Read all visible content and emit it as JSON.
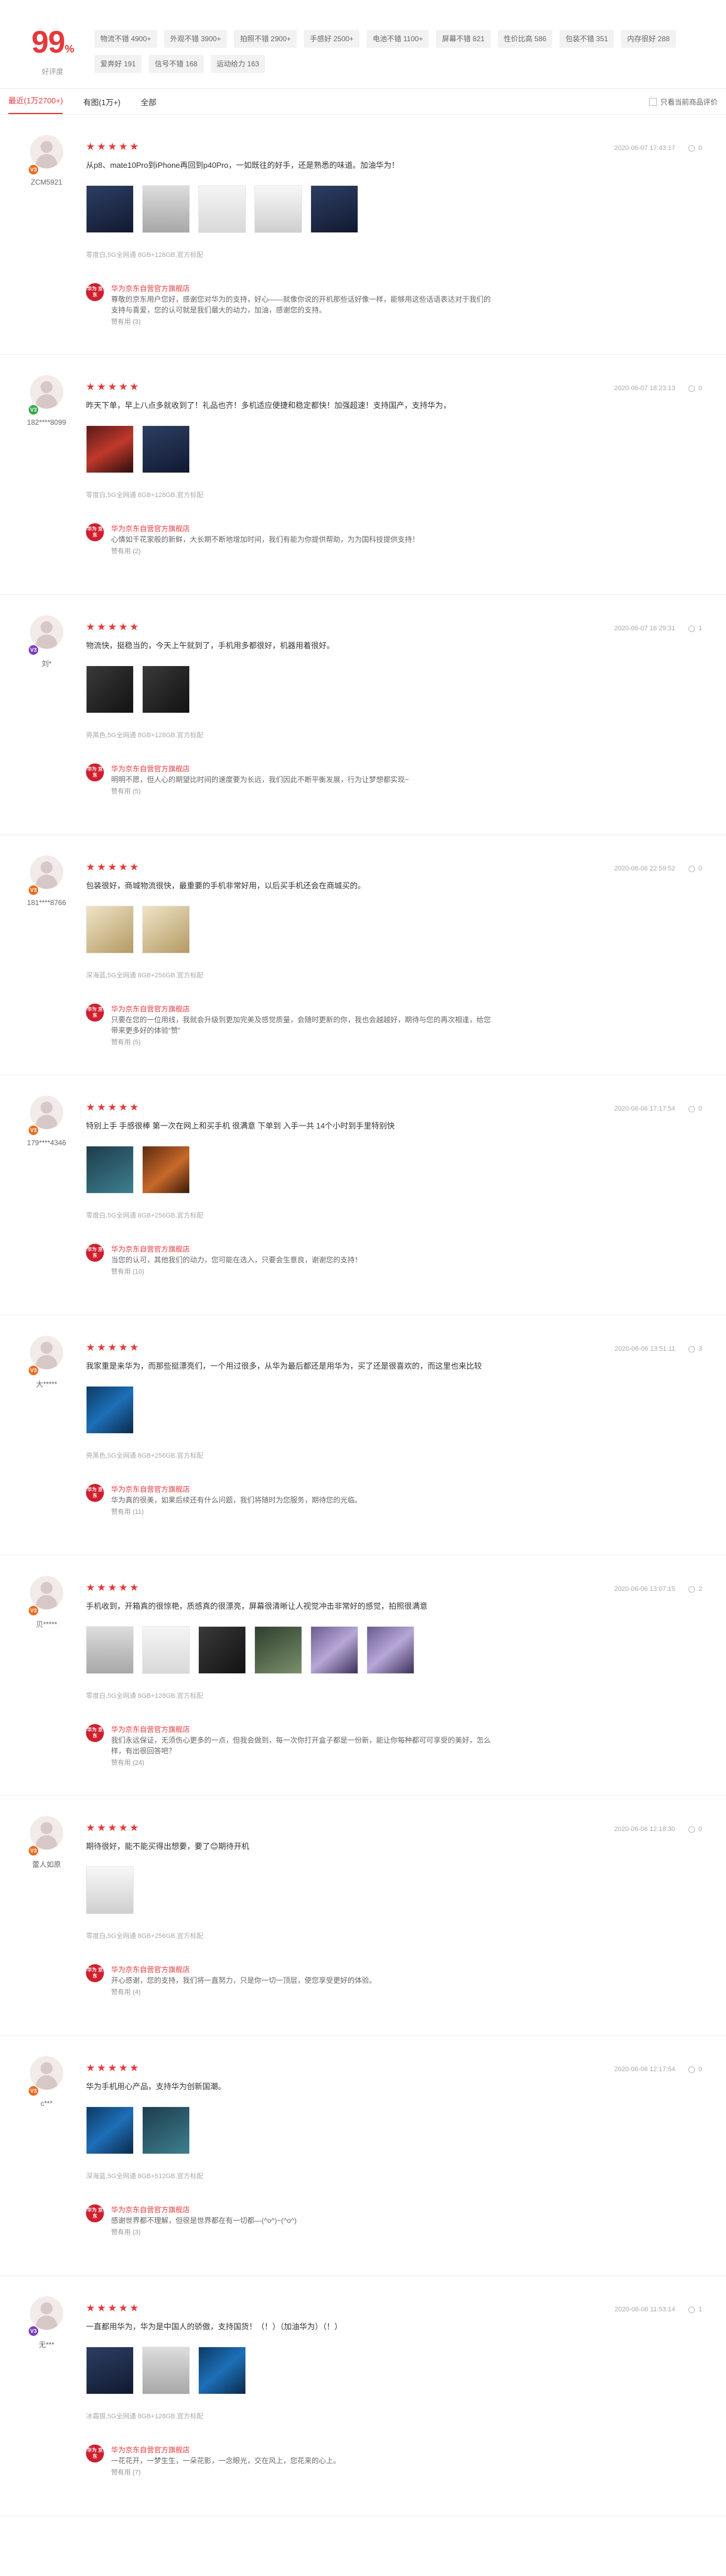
{
  "summary": {
    "rate": "99",
    "rate_unit": "%",
    "rate_label": "好评度",
    "tags": [
      "物流不错 4900+",
      "外观不错 3900+",
      "拍照不错 2900+",
      "手感好 2500+",
      "电池不错 1100+",
      "屏幕不错 821",
      "性价比高 586",
      "包装不错 351",
      "内存很好 288",
      "爱奔好 191",
      "信号不错 168",
      "运动给力 163"
    ]
  },
  "filters": {
    "tabs": [
      "最近(1万2700+)",
      "有图(1万+)",
      "全部"
    ],
    "only_current": "只看当前商品评价"
  },
  "colors": {
    "accent": "#e4393c"
  },
  "reviews": [
    {
      "user": "ZCM5921",
      "level": "V3",
      "stars": "★★★★★",
      "text": "从p8、mate10Pro到iPhone再回到p40Pro，一如既往的好手，还是熟悉的味道。加油华为！",
      "photos": [
        "p-navy",
        "p-box",
        "p-white",
        "p-light",
        "p-navy"
      ],
      "order": "零度白,5G全网通 8GB+128GB,官方标配",
      "shop": "华为京东自营官方旗舰店",
      "shop_logo": "华为 京东",
      "reply": "尊敬的京东用户您好，感谢您对华为的支持，好心——就像你说的开机那些话好像一样，能够用这些话语表达对于我们的支持与喜爱，您的认可就是我们最大的动力，加油，感谢您的支持。",
      "helpful": "赞有用",
      "helpful_count": "(3)",
      "date": "2020-06-07 17:43:17",
      "likes": "0"
    },
    {
      "user": "182****8099",
      "level": "V3",
      "stars": "★★★★★",
      "text": "昨天下单，早上八点多就收到了！礼品也齐！多机适应便捷和稳定都快！加强超速！支持国产，支持华为，",
      "photos": [
        "p-red",
        "p-navy"
      ],
      "order": "零度白,5G全网通 8GB+128GB,官方标配",
      "shop": "华为京东自营官方旗舰店",
      "shop_logo": "华为 京东",
      "reply": "心情如千花家般的新鲜，大长期不断地增加时间，我们有能为你提供帮助，为为国科技提供支持！",
      "helpful": "赞有用",
      "helpful_count": "(2)",
      "date": "2020-06-07 18:23:13",
      "likes": "0"
    },
    {
      "user": "刘*",
      "level": "V3",
      "stars": "★★★★★",
      "text": "物流快，挺稳当的，今天上午就到了，手机用多都很好，机器用着很好。",
      "photos": [
        "p-dark",
        "p-dark"
      ],
      "order": "亮黑色,5G全网通 8GB+128GB,官方标配",
      "shop": "华为京东自营官方旗舰店",
      "shop_logo": "华为 京东",
      "reply": "明明不愿，但人心的期望比时间的速度要为长远，我们因此不断平衡发展，行为让梦想都实现~",
      "helpful": "赞有用",
      "helpful_count": "(5)",
      "date": "2020-06-07 16:29:31",
      "likes": "1"
    },
    {
      "user": "181****8766",
      "level": "V3",
      "stars": "★★★★★",
      "text": "包装很好，商城物流很快，最重要的手机非常好用，以后买手机还会在商城买的。",
      "photos": [
        "p-gold",
        "p-gold"
      ],
      "order": "深海蓝,5G全网通 8GB+256GB,官方标配",
      "shop": "华为京东自营官方旗舰店",
      "shop_logo": "华为 京东",
      "reply": "只要在您的一位用线，我就会升级到更加完美及感觉质量，会随时更新的你，我也会越越好，期待与您的再次相逢，给您带来更多好的体验“赞”",
      "helpful": "赞有用",
      "helpful_count": "(5)",
      "date": "2020-06-06 22:59:52",
      "likes": "0"
    },
    {
      "user": "179****4346",
      "level": "V3",
      "stars": "★★★★★",
      "text": "特别上手 手感很棒 第一次在网上和买手机 很满意 下单到 入手一共 14个小时到手里特别快",
      "photos": [
        "p-teal",
        "p-orange"
      ],
      "order": "零度白,5G全网通 8GB+256GB,官方标配",
      "shop": "华为京东自营官方旗舰店",
      "shop_logo": "华为 京东",
      "reply": "当您的认可，其他我们的动力，您可能在选入，只要会生意良，谢谢您的支持！",
      "helpful": "赞有用",
      "helpful_count": "(10)",
      "date": "2020-06-06 17:17:54",
      "likes": "0"
    },
    {
      "user": "大*****",
      "level": "V3",
      "stars": "★★★★★",
      "text": "我家重是来华为，而那些挺漂亮们，一个用过很多，从华为最后都还是用华为，买了还是很喜欢的，而这里也来比较",
      "photos": [
        "p-blue"
      ],
      "order": "亮黑色,5G全网通 8GB+256GB,官方标配",
      "shop": "华为京东自营官方旗舰店",
      "shop_logo": "华为 京东",
      "reply": "华为真的很美，如果后续还有什么问题，我们将随时为您服务，期待您的光临。",
      "helpful": "赞有用",
      "helpful_count": "(11)",
      "date": "2020-06-06 13:51:11",
      "likes": "3"
    },
    {
      "user": "贝*****",
      "level": "V3",
      "stars": "★★★★★",
      "text": "手机收到，开箱真的很惊艳，质感真的很漂亮，屏幕很清晰让人视觉冲击非常好的感觉，拍照很满意",
      "photos": [
        "p-box",
        "p-white",
        "p-dark",
        "p-green",
        "p-purple",
        "p-purple"
      ],
      "order": "零度白,5G全网通 8GB+128GB,官方标配",
      "shop": "华为京东自营官方旗舰店",
      "shop_logo": "华为 京东",
      "reply": "我们永远保证，无须伤心更多的一点，但我会做到，每一次你打开盒子都是一份新，能让你每种都可可享受的美好，怎么样，有出很回答吧？",
      "helpful": "赞有用",
      "helpful_count": "(24)",
      "date": "2020-06-06 13:07:15",
      "likes": "2"
    },
    {
      "user": "蕾人如原",
      "level": "V3",
      "stars": "★★★★★",
      "text": "期待很好，能不能买得出想要，要了😊期待开机",
      "photos": [
        "p-light"
      ],
      "order": "零度白,5G全网通 8GB+256GB,官方标配",
      "shop": "华为京东自营官方旗舰店",
      "shop_logo": "华为 京东",
      "reply": "开心感谢，您的支持，我们将一直努力，只是你一切一顶层，使您享受更好的体验。",
      "helpful": "赞有用",
      "helpful_count": "(4)",
      "date": "2020-06-06 12:18:30",
      "likes": "0"
    },
    {
      "user": "c***",
      "level": "V3",
      "stars": "★★★★★",
      "text": "华为手机用心产品，支持华为创新国潮。",
      "photos": [
        "p-blue",
        "p-teal"
      ],
      "order": "深海蓝,5G全网通 8GB+512GB,官方标配",
      "shop": "华为京东自营官方旗舰店",
      "shop_logo": "华为 京东",
      "reply": "感谢世界都不理解，但很是世界都在有一切都—(^o^)~(^o^)",
      "helpful": "赞有用",
      "helpful_count": "(3)",
      "date": "2020-06-06 12:17:54",
      "likes": "0"
    },
    {
      "user": "无***",
      "level": "V3",
      "stars": "★★★★★",
      "text": "一直都用华为，华为是中国人的骄傲，支持国货！（！）（加油华为）（！）",
      "photos": [
        "p-navy",
        "p-box",
        "p-blue"
      ],
      "order": "冰霜银,5G全网通 8GB+128GB,官方标配",
      "shop": "华为京东自营官方旗舰店",
      "shop_logo": "华为 京东",
      "reply": "一花花开，一梦生生，一朵花影，一念眼光，交在风上，您花来的心上。",
      "helpful": "赞有用",
      "helpful_count": "(7)",
      "date": "2020-06-06 11:53:14",
      "likes": "1"
    }
  ]
}
